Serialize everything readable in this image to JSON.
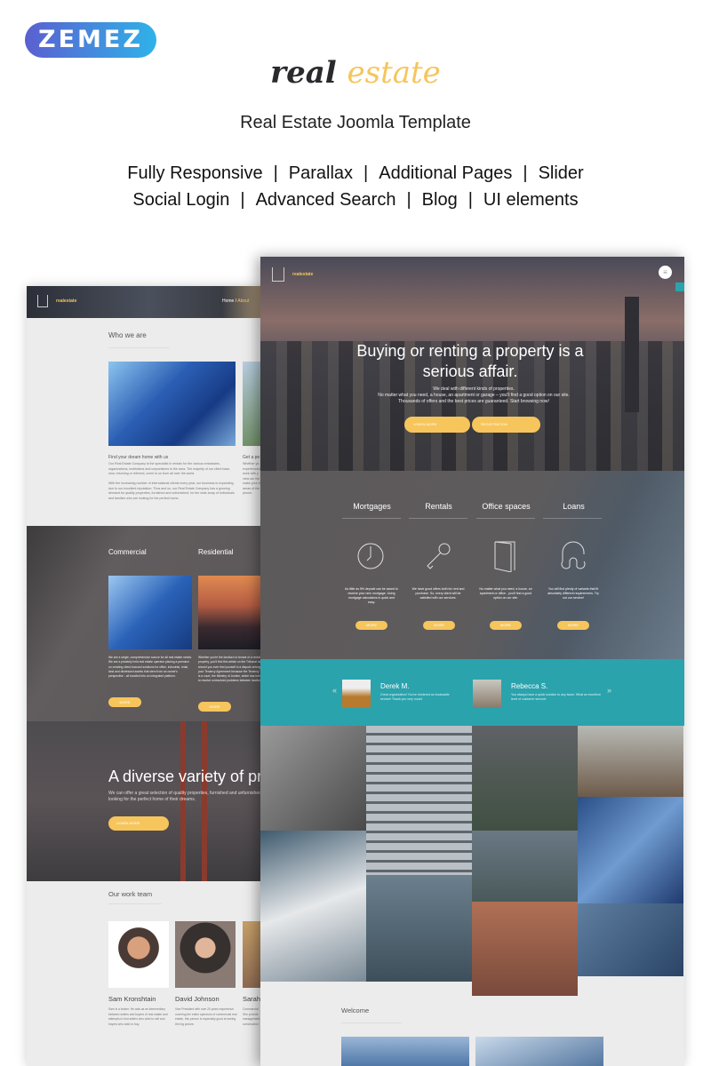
{
  "promo": {
    "vendor_logo": "ZEMEZ",
    "brand_word1": "real",
    "brand_word2": "estate",
    "tagline": "Real Estate Joomla Template",
    "features_row1": [
      "Fully Responsive",
      "Parallax",
      "Additional Pages",
      "Slider"
    ],
    "features_row2": [
      "Social Login",
      "Advanced Search",
      "Blog",
      "UI elements"
    ],
    "separator": "|"
  },
  "left_page": {
    "logo": "realestate",
    "breadcrumb": {
      "home": "Home",
      "sep": "/",
      "current": "About"
    },
    "who_title": "Who we are",
    "col1_title": "Find your dream home with us",
    "col1_p1": "Our Real Estate Company is the specialist in rentals for the various embassies, organizations, institutions and corporations in the area. The majority of our client base, new, returning or referred, come to us from all over the world.",
    "col1_p2": "With the increasing number of international clients every year, our business is expanding due to our excellent reputation. Thus and so, our Real Estate Company has a growing demand for quality properties, furnished and unfurnished, for the wide array of individuals and families who are looking for the perfect home.",
    "col2_title": "Get a pe",
    "col2_text": "Whether yo experienced work with y view our list make your b areas of the phone.",
    "commercial": {
      "title": "Commercial",
      "text": "We are a single, comprehensive source for all real estate needs. We are a privately held real estate operator placing a premium on creating client-focused solutions for office, industrial, retail, land and distressed assets that stem from an owner's perspective - all bundled into an integrated platform.",
      "button": "MORE"
    },
    "residential": {
      "title": "Residential",
      "text": "Whether you're the landlord or tenant of a rental property, you'll find this article on the Tribunal useful, should you ever find yourself in a dispute arising out of your Tenancy Agreement because the Tenancy Tribunal is a court, the Ministry of Justice, which has been set up to resolve unresolved problems between landlords and",
      "button": "MORE"
    },
    "parallax": {
      "title": "A diverse variety of pro",
      "text": "We can offer a great selection of quality properties, furnished and unfurnished, for those looking for the perfect home of their dreams.",
      "button": "LEARN MORE"
    },
    "team_title": "Our work team",
    "team": [
      {
        "name": "Sam Kronshtain",
        "bio": "Sam is a broker. He acts as an intermediary between sellers and buyers of real estate and attempts to find sellers who wish to sell and buyers who wish to buy."
      },
      {
        "name": "David Johnson",
        "bio": "Vice President with over 20 years experience covering the entire spectrum of commercial real estate, this person is especially good at seeing the big picture."
      },
      {
        "name": "Sarah",
        "bio": "Commercial She provide management construction"
      }
    ]
  },
  "right_page": {
    "logo": "realestate",
    "hero": {
      "title": "Buying or renting a property is a serious affair.",
      "line1": "We deal with different kinds of properties.",
      "line2": "No matter what you need, a house, an apartment or garage – you'll find a good option on our site.",
      "line3": "Thousands of offers and the best prices are guaranteed. Start browsing now!",
      "btn1": "LEARN MORE",
      "btn2": "REGISTRATION"
    },
    "services": [
      {
        "title": "Mortgages",
        "icon": "clock-icon",
        "text": "As little as 5% deposit can be saved to receive your new mortgage. Using mortgage calculators is quick and easy.",
        "button": "MORE"
      },
      {
        "title": "Rentals",
        "icon": "key-icon",
        "text": "We have good offers both for rent and purchase. So, every client will be satisfied with our services.",
        "button": "MORE"
      },
      {
        "title": "Office spaces",
        "icon": "door-icon",
        "text": "No matter what you need, a house, an apartment or office - you'll find a good option on our site.",
        "button": "MORE"
      },
      {
        "title": "Loans",
        "icon": "lock-icon",
        "text": "You will find plenty of variants that fit absolutely different requirements. Try out our service!",
        "button": "MORE"
      }
    ],
    "testimonials": [
      {
        "name": "Derek M.",
        "text": "Great organization! You've rendered an invaluable service! Thank you very much!"
      },
      {
        "name": "Rebecca S.",
        "text": "You always have a quick solution to any issue. What an excellent level of customer service!"
      }
    ],
    "nav": {
      "prev": "«",
      "next": "»"
    },
    "welcome_title": "Welcome"
  },
  "colors": {
    "accent": "#f6c55c",
    "teal": "#2aa3ad",
    "dark": "#2a2a2e"
  }
}
